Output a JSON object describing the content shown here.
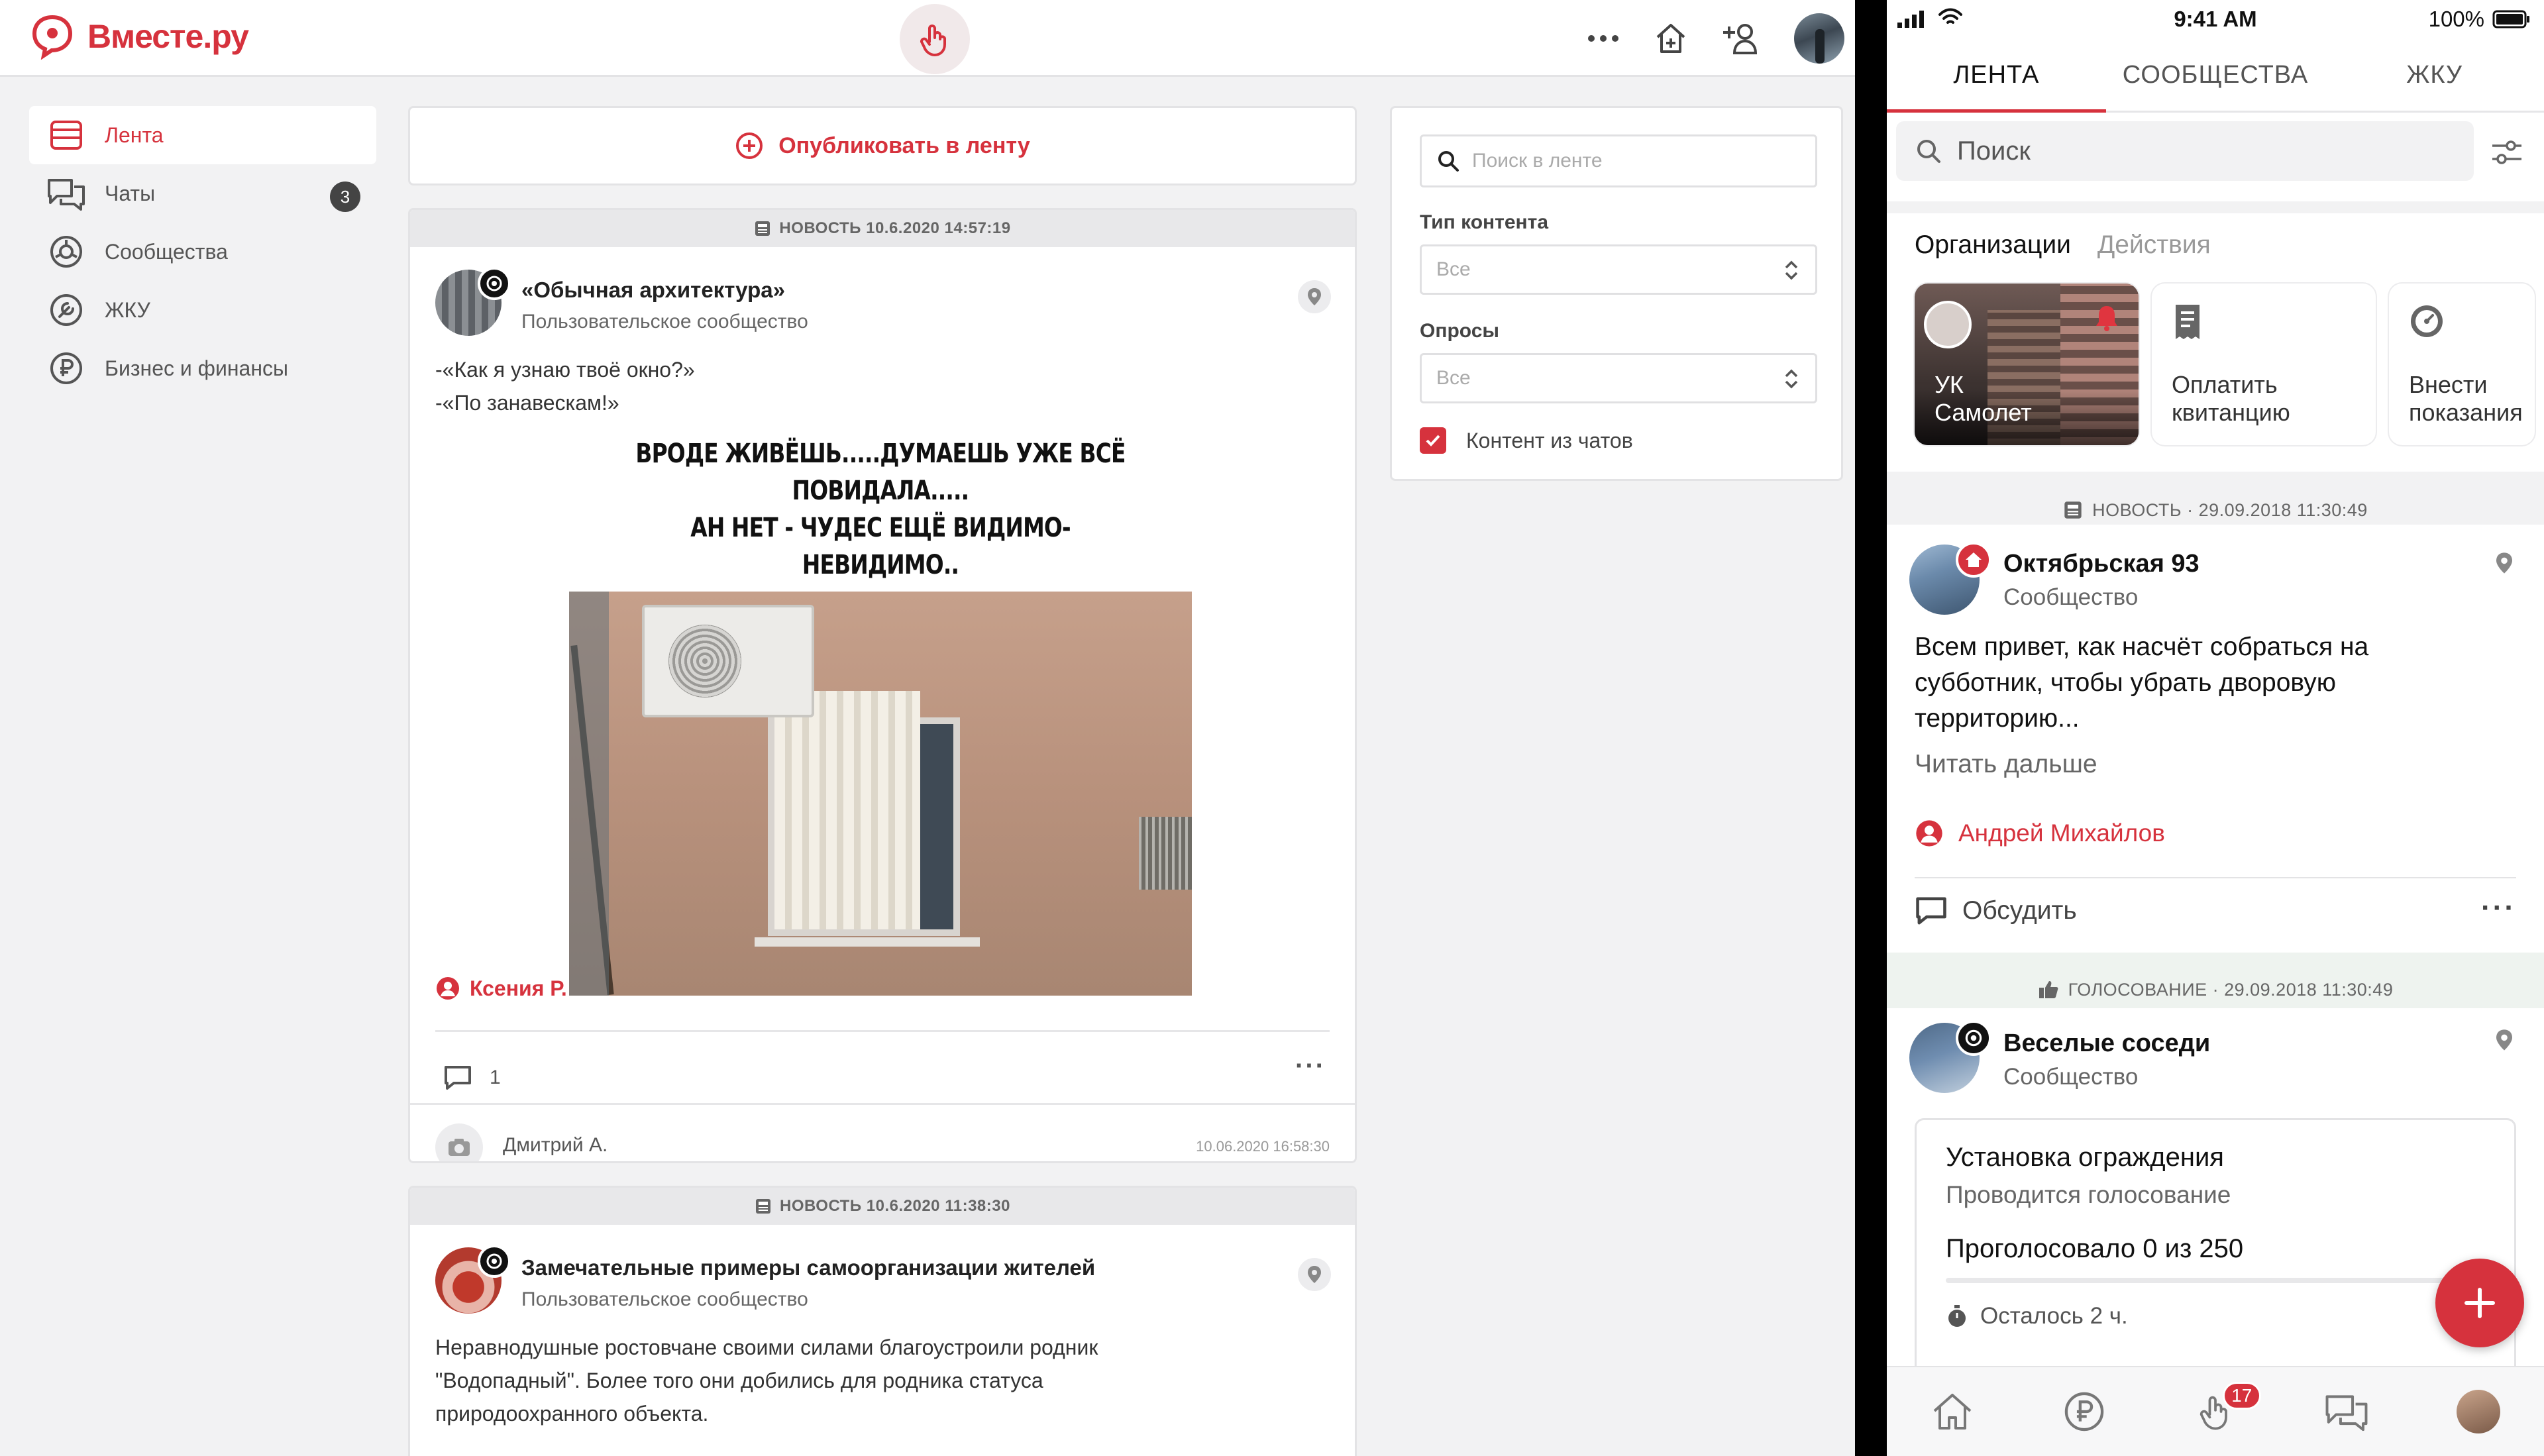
{
  "desktop": {
    "logo_text": "Вместе.ру",
    "sidebar": {
      "items": [
        {
          "label": "Лента",
          "icon": "feed-icon",
          "active": true
        },
        {
          "label": "Чаты",
          "icon": "chats-icon",
          "badge": "3"
        },
        {
          "label": "Сообщества",
          "icon": "communities-icon"
        },
        {
          "label": "ЖКУ",
          "icon": "utilities-icon"
        },
        {
          "label": "Бизнес и финансы",
          "icon": "ruble-icon"
        }
      ]
    },
    "publish_label": "Опубликовать в ленту",
    "posts": [
      {
        "header": "НОВОСТЬ 10.6.2020 14:57:19",
        "title": "«Обычная архитектура»",
        "subtitle": "Пользовательское сообщество",
        "text_lines": [
          "-«Как я узнаю твоё окно?»",
          "-«По занавескам!»"
        ],
        "meme_caption": [
          "ВРОДЕ ЖИВЁШЬ.....ДУМАЕШЬ УЖЕ ВСЁ ПОВИДАЛА.....",
          "АН НЕТ - ЧУДЕС ЕЩЁ ВИДИМО-НЕВИДИМО.."
        ],
        "author": "Ксения Р.",
        "comments": "1",
        "reply_name": "Дмитрий А.",
        "reply_time": "10.06.2020 16:58:30"
      },
      {
        "header": "НОВОСТЬ 10.6.2020 11:38:30",
        "title": "Замечательные примеры самоорганизации жителей",
        "subtitle": "Пользовательское сообщество",
        "text_lines": [
          "Неравнодушные ростовчане своими силами благоустроили родник",
          "\"Водопадный\". Более того они добились для родника статуса",
          "природоохранного объекта."
        ]
      }
    ],
    "filters": {
      "search_placeholder": "Поиск в ленте",
      "content_type_label": "Тип контента",
      "content_type_value": "Все",
      "polls_label": "Опросы",
      "polls_value": "Все",
      "chat_content_label": "Контент из чатов",
      "chat_content_checked": true
    }
  },
  "phone": {
    "status": {
      "time": "9:41 AM",
      "battery": "100%"
    },
    "tabs": [
      {
        "label": "ЛЕНТА",
        "active": true
      },
      {
        "label": "СООБЩЕСТВА"
      },
      {
        "label": "ЖКУ"
      }
    ],
    "search_placeholder": "Поиск",
    "org_tabs": {
      "active": "Организации",
      "inactive": "Действия"
    },
    "org_cards": [
      {
        "label_lines": [
          "УК",
          "Самолет"
        ]
      },
      {
        "label_lines": [
          "Оплатить",
          "квитанцию"
        ],
        "icon": "receipt-icon"
      },
      {
        "label_lines": [
          "Внести",
          "показания"
        ],
        "icon": "meter-icon"
      }
    ],
    "posts": [
      {
        "header": "НОВОСТЬ · 29.09.2018 11:30:49",
        "title": "Октябрьская 93",
        "subtitle": "Сообщество",
        "text_lines": [
          "Всем привет, как насчёт собраться на",
          "субботник, чтобы убрать дворовую",
          "территорию..."
        ],
        "read_more": "Читать дальше",
        "author": "Андрей Михайлов",
        "discuss": "Обсудить"
      },
      {
        "header": "ГОЛОСОВАНИЕ · 29.09.2018 11:30:49",
        "title": "Веселые соседи",
        "subtitle": "Сообщество",
        "vote": {
          "title": "Установка ограждения",
          "status": "Проводится голосование",
          "count_text": "Проголосовало 0 из 250",
          "voted": 0,
          "total": 250,
          "remaining": "Осталось 2 ч."
        }
      }
    ],
    "bottom_nav": [
      {
        "icon": "home-icon"
      },
      {
        "icon": "ruble-icon"
      },
      {
        "icon": "hand-icon",
        "badge": "17"
      },
      {
        "icon": "chat-icon"
      },
      {
        "icon": "profile-avatar"
      }
    ],
    "colors": {
      "accent": "#d6323d",
      "text": "#111111",
      "muted": "#666666"
    }
  }
}
